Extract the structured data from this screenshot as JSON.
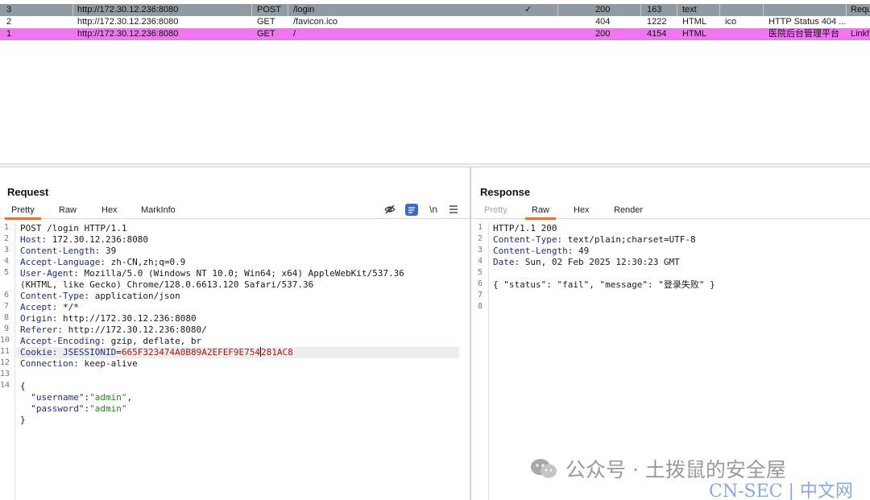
{
  "history": {
    "rows": [
      {
        "num": "3",
        "host": "http://172.30.12.236:8080",
        "method": "POST",
        "url": "/login",
        "edited": "✓",
        "status": "200",
        "length": "163",
        "mime": "text",
        "ext": "",
        "title": "",
        "extra": "Requ"
      },
      {
        "num": "2",
        "host": "http://172.30.12.236:8080",
        "method": "GET",
        "url": "/favicon.ico",
        "edited": "",
        "status": "404",
        "length": "1222",
        "mime": "HTML",
        "ext": "ico",
        "title": "HTTP Status 404 ...",
        "extra": ""
      },
      {
        "num": "1",
        "host": "http://172.30.12.236:8080",
        "method": "GET",
        "url": "/",
        "edited": "",
        "status": "200",
        "length": "4154",
        "mime": "HTML",
        "ext": "",
        "title": "医院后台管理平台",
        "extra": "Linkf"
      }
    ]
  },
  "request": {
    "title": "Request",
    "tabs": [
      "Pretty",
      "Raw",
      "Hex",
      "MarkInfo"
    ],
    "active_tab": "Pretty",
    "tools": {
      "hide": "eye-off-icon",
      "pretty": "pretty-print-icon",
      "newline": "\\n",
      "menu": "menu-icon"
    },
    "line_numbers": [
      "1",
      "2",
      "3",
      "4",
      "5",
      "",
      "6",
      "7",
      "8",
      "9",
      "10",
      "11",
      "12",
      "13",
      "14",
      "",
      "",
      "",
      ""
    ],
    "lines": [
      {
        "text": "POST /login HTTP/1.1"
      },
      {
        "key": "Host",
        "val": "172.30.12.236:8080"
      },
      {
        "key": "Content-Length",
        "val": "39"
      },
      {
        "key": "Accept-Language",
        "val": "zh-CN,zh;q=0.9"
      },
      {
        "key": "User-Agent",
        "val": "Mozilla/5.0 (Windows NT 10.0; Win64; x64) AppleWebKit/537.36"
      },
      {
        "text": "(KHTML, like Gecko) Chrome/128.0.6613.120 Safari/537.36"
      },
      {
        "key": "Content-Type",
        "val": "application/json"
      },
      {
        "key": "Accept",
        "val": "*/*"
      },
      {
        "key": "Origin",
        "val": "http://172.30.12.236:8080"
      },
      {
        "key": "Referer",
        "val": "http://172.30.12.236:8080/"
      },
      {
        "key": "Accept-Encoding",
        "val": "gzip, deflate, br"
      },
      {
        "key": "Cookie",
        "cookie_name": "JSESSIONID",
        "cookie_val_a": "665F323474A0B89A2EFEF9E754",
        "cookie_val_b": "281AC8"
      },
      {
        "key": "Connection",
        "val": "keep-alive"
      },
      {
        "text": ""
      },
      {
        "text": "{"
      },
      {
        "json_key": "\"username\"",
        "json_val": "\"admin\"",
        "trail": ","
      },
      {
        "json_key": "\"password\"",
        "json_val": "\"admin\"",
        "trail": ""
      },
      {
        "text": "}"
      }
    ]
  },
  "response": {
    "title": "Response",
    "tabs": [
      "Pretty",
      "Raw",
      "Hex",
      "Render"
    ],
    "active_tab": "Raw",
    "line_numbers": [
      "1",
      "2",
      "3",
      "4",
      "5",
      "6",
      "7",
      "8"
    ],
    "lines": [
      {
        "text": "HTTP/1.1 200"
      },
      {
        "key": "Content-Type",
        "val": "text/plain;charset=UTF-8"
      },
      {
        "key": "Content-Length",
        "val": "49"
      },
      {
        "key": "Date",
        "val": "Sun, 02 Feb 2025 12:30:23 GMT"
      },
      {
        "text": ""
      },
      {
        "text": "{ \"status\": \"fail\", \"message\": \"登录失败\" }"
      },
      {
        "text": ""
      },
      {
        "text": ""
      }
    ]
  },
  "watermark": {
    "text": "公众号 · 土拨鼠的安全屋",
    "site": "CN-SEC | 中文网"
  },
  "colors": {
    "selected_row": "#8f9aa3",
    "highlight_row": "#f075f0",
    "tab_accent": "#e8713c"
  }
}
